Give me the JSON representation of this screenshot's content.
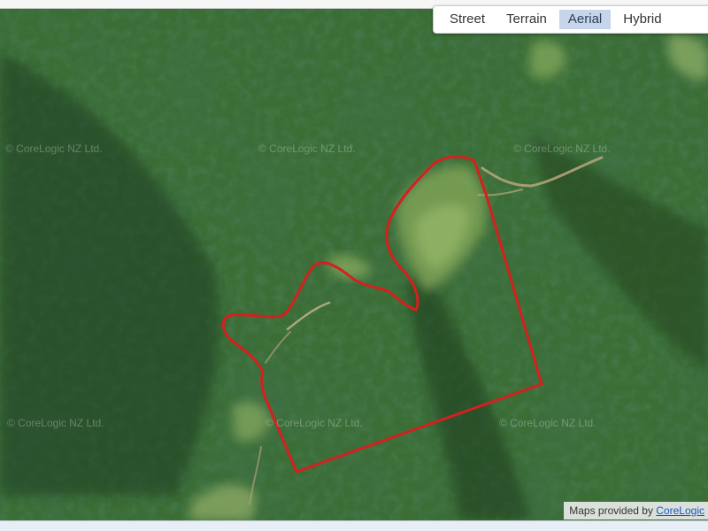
{
  "map": {
    "type_buttons": [
      {
        "label": "Street",
        "active": false
      },
      {
        "label": "Terrain",
        "active": false
      },
      {
        "label": "Aerial",
        "active": true
      },
      {
        "label": "Hybrid",
        "active": false
      }
    ],
    "watermarks": [
      "© CoreLogic NZ Ltd.",
      "© CoreLogic NZ Ltd.",
      "© CoreLogic NZ Ltd.",
      "© CoreLogic NZ Ltd.",
      "© CoreLogic NZ Ltd.",
      "© CoreLogic NZ Ltd."
    ],
    "attribution": {
      "prefix": "Maps provided by ",
      "link_text": "CoreLogic"
    },
    "colors": {
      "boundary": "#d61f1f",
      "active_button": "#c7d5ea",
      "attribution_link": "#1a55cc"
    }
  }
}
